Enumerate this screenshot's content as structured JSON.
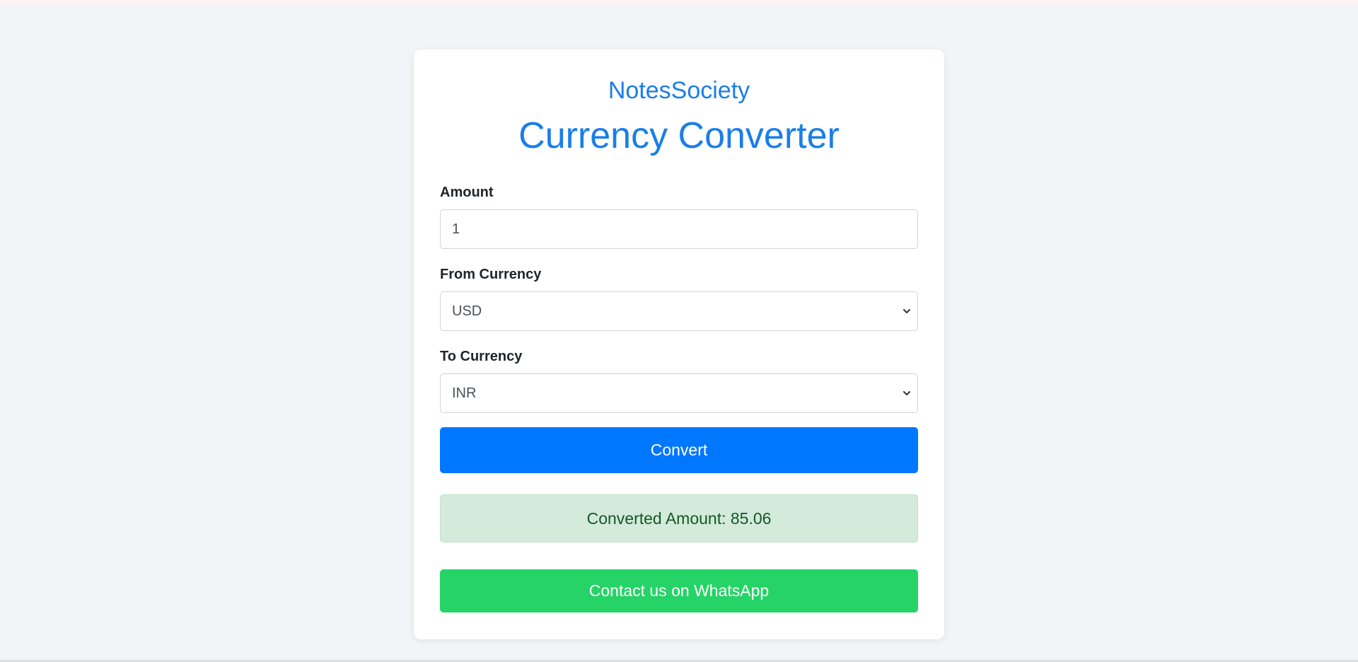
{
  "brand": "NotesSociety",
  "title": "Currency Converter",
  "form": {
    "amount_label": "Amount",
    "amount_value": "1",
    "from_label": "From Currency",
    "from_value": "USD",
    "to_label": "To Currency",
    "to_value": "INR",
    "convert_label": "Convert"
  },
  "result": {
    "text": "Converted Amount: 85.06"
  },
  "contact": {
    "whatsapp_label": "Contact us on WhatsApp"
  },
  "colors": {
    "accent": "#0077ff",
    "heading": "#1a7ee8",
    "success_bg": "#d4eadb",
    "success_text": "#135a26",
    "whatsapp": "#25d366",
    "page_bg": "#f2f5f8"
  },
  "icons": {
    "select_chevron": "chevron-down-icon"
  }
}
